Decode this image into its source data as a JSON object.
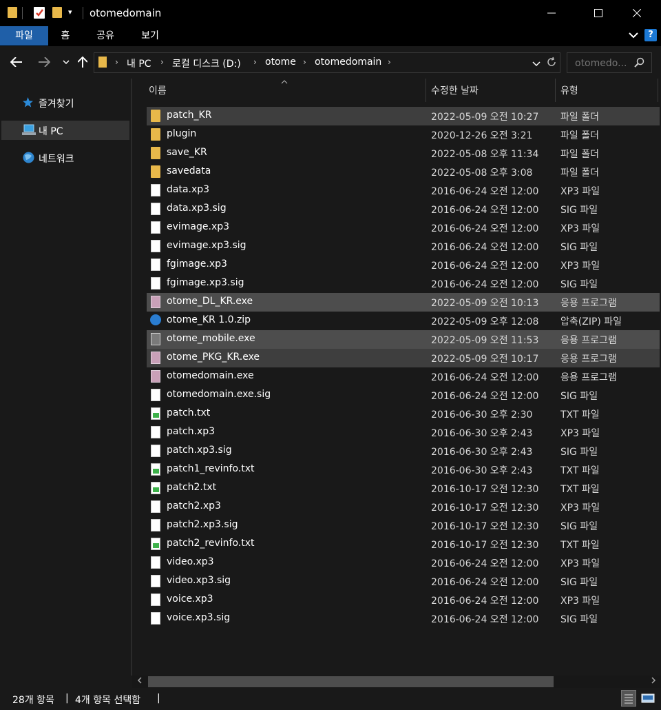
{
  "window": {
    "title": "otomedomain"
  },
  "ribbon": {
    "tabs": [
      "파일",
      "홈",
      "공유",
      "보기"
    ],
    "help_label": "?"
  },
  "address": {
    "crumbs": [
      "내 PC",
      "로컬 디스크 (D:)",
      "otome",
      "otomedomain"
    ],
    "search_placeholder": "otomedo..."
  },
  "nav": {
    "items": [
      {
        "label": "즐겨찾기",
        "icon": "star-icon"
      },
      {
        "label": "내 PC",
        "icon": "computer-icon"
      },
      {
        "label": "네트워크",
        "icon": "network-icon"
      }
    ]
  },
  "columns": {
    "name": "이름",
    "date": "수정한 날짜",
    "type": "유형"
  },
  "files": [
    {
      "name": "patch_KR",
      "date": "2022-05-09 오전 10:27",
      "type": "파일 폴더",
      "icon": "folder-icon",
      "selected": true
    },
    {
      "name": "plugin",
      "date": "2020-12-26 오전 3:21",
      "type": "파일 폴더",
      "icon": "folder-icon",
      "selected": false
    },
    {
      "name": "save_KR",
      "date": "2022-05-08 오후 11:34",
      "type": "파일 폴더",
      "icon": "folder-icon",
      "selected": false
    },
    {
      "name": "savedata",
      "date": "2022-05-08 오후 3:08",
      "type": "파일 폴더",
      "icon": "folder-icon",
      "selected": false
    },
    {
      "name": "data.xp3",
      "date": "2016-06-24 오전 12:00",
      "type": "XP3 파일",
      "icon": "file-icon",
      "selected": false
    },
    {
      "name": "data.xp3.sig",
      "date": "2016-06-24 오전 12:00",
      "type": "SIG 파일",
      "icon": "file-icon",
      "selected": false
    },
    {
      "name": "evimage.xp3",
      "date": "2016-06-24 오전 12:00",
      "type": "XP3 파일",
      "icon": "file-icon",
      "selected": false
    },
    {
      "name": "evimage.xp3.sig",
      "date": "2016-06-24 오전 12:00",
      "type": "SIG 파일",
      "icon": "file-icon",
      "selected": false
    },
    {
      "name": "fgimage.xp3",
      "date": "2016-06-24 오전 12:00",
      "type": "XP3 파일",
      "icon": "file-icon",
      "selected": false
    },
    {
      "name": "fgimage.xp3.sig",
      "date": "2016-06-24 오전 12:00",
      "type": "SIG 파일",
      "icon": "file-icon",
      "selected": false
    },
    {
      "name": "otome_DL_KR.exe",
      "date": "2022-05-09 오전 10:13",
      "type": "응용 프로그램",
      "icon": "app-icon",
      "selected": true
    },
    {
      "name": "otome_KR 1.0.zip",
      "date": "2022-05-09 오후 12:08",
      "type": "압축(ZIP) 파일",
      "icon": "zip-icon",
      "selected": false
    },
    {
      "name": "otome_mobile.exe",
      "date": "2022-05-09 오전 11:53",
      "type": "응용 프로그램",
      "icon": "app-mobile-icon",
      "selected": true
    },
    {
      "name": "otome_PKG_KR.exe",
      "date": "2022-05-09 오전 10:17",
      "type": "응용 프로그램",
      "icon": "app-icon",
      "selected": true
    },
    {
      "name": "otomedomain.exe",
      "date": "2016-06-24 오전 12:00",
      "type": "응용 프로그램",
      "icon": "app-icon",
      "selected": false
    },
    {
      "name": "otomedomain.exe.sig",
      "date": "2016-06-24 오전 12:00",
      "type": "SIG 파일",
      "icon": "file-icon",
      "selected": false
    },
    {
      "name": "patch.txt",
      "date": "2016-06-30 오후 2:30",
      "type": "TXT 파일",
      "icon": "text-file-icon",
      "selected": false
    },
    {
      "name": "patch.xp3",
      "date": "2016-06-30 오후 2:43",
      "type": "XP3 파일",
      "icon": "file-icon",
      "selected": false
    },
    {
      "name": "patch.xp3.sig",
      "date": "2016-06-30 오후 2:43",
      "type": "SIG 파일",
      "icon": "file-icon",
      "selected": false
    },
    {
      "name": "patch1_revinfo.txt",
      "date": "2016-06-30 오후 2:43",
      "type": "TXT 파일",
      "icon": "text-file-icon",
      "selected": false
    },
    {
      "name": "patch2.txt",
      "date": "2016-10-17 오전 12:30",
      "type": "TXT 파일",
      "icon": "text-file-icon",
      "selected": false
    },
    {
      "name": "patch2.xp3",
      "date": "2016-10-17 오전 12:30",
      "type": "XP3 파일",
      "icon": "file-icon",
      "selected": false
    },
    {
      "name": "patch2.xp3.sig",
      "date": "2016-10-17 오전 12:30",
      "type": "SIG 파일",
      "icon": "file-icon",
      "selected": false
    },
    {
      "name": "patch2_revinfo.txt",
      "date": "2016-10-17 오전 12:30",
      "type": "TXT 파일",
      "icon": "text-file-icon",
      "selected": false
    },
    {
      "name": "video.xp3",
      "date": "2016-06-24 오전 12:00",
      "type": "XP3 파일",
      "icon": "file-icon",
      "selected": false
    },
    {
      "name": "video.xp3.sig",
      "date": "2016-06-24 오전 12:00",
      "type": "SIG 파일",
      "icon": "file-icon",
      "selected": false
    },
    {
      "name": "voice.xp3",
      "date": "2016-06-24 오전 12:00",
      "type": "XP3 파일",
      "icon": "file-icon",
      "selected": false
    },
    {
      "name": "voice.xp3.sig",
      "date": "2016-06-24 오전 12:00",
      "type": "SIG 파일",
      "icon": "file-icon",
      "selected": false
    }
  ],
  "status": {
    "item_count": "28개 항목",
    "selected_count": "4개 항목 선택함",
    "sep": "|"
  }
}
